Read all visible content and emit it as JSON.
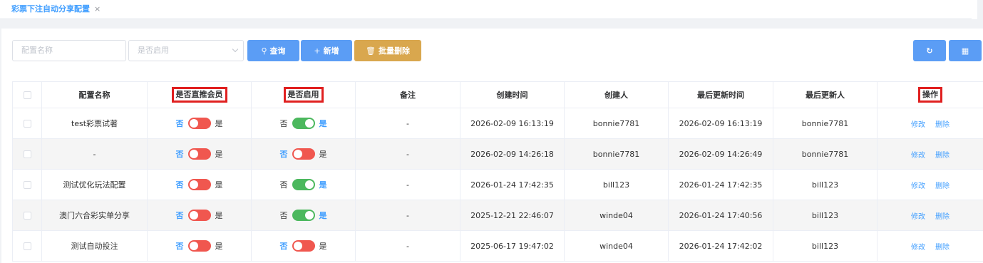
{
  "tab": {
    "title": "彩票下注自动分享配置",
    "close": "×"
  },
  "toolbar": {
    "name_placeholder": "配置名称",
    "enabled_placeholder": "是否启用",
    "query_label": "查询",
    "add_label": "新增",
    "batch_delete_label": "批量删除"
  },
  "table": {
    "headers": {
      "name": "配置名称",
      "direct_member": "是否直推会员",
      "enabled": "是否启用",
      "remark": "备注",
      "created_at": "创建时间",
      "creator": "创建人",
      "updated_at": "最后更新时间",
      "updater": "最后更新人",
      "actions": "操作"
    },
    "switch_no": "否",
    "switch_yes": "是",
    "edit_label": "修改",
    "delete_label": "删除",
    "rows": [
      {
        "name": "test彩票试著",
        "direct_member": false,
        "enabled": true,
        "remark": "-",
        "created_at": "2026-02-09 16:13:19",
        "creator": "bonnie7781",
        "updated_at": "2026-02-09 16:13:19",
        "updater": "bonnie7781"
      },
      {
        "name": "-",
        "direct_member": false,
        "enabled": false,
        "remark": "-",
        "created_at": "2026-02-09 14:26:18",
        "creator": "bonnie7781",
        "updated_at": "2026-02-09 14:26:49",
        "updater": "bonnie7781"
      },
      {
        "name": "测试优化玩法配置",
        "direct_member": false,
        "enabled": true,
        "remark": "-",
        "created_at": "2026-01-24 17:42:35",
        "creator": "bill123",
        "updated_at": "2026-01-24 17:42:35",
        "updater": "bill123"
      },
      {
        "name": "澳门六合彩实单分享",
        "direct_member": false,
        "enabled": true,
        "remark": "-",
        "created_at": "2025-12-21 22:46:07",
        "creator": "winde04",
        "updated_at": "2026-01-24 17:40:56",
        "updater": "bill123"
      },
      {
        "name": "测试自动投注",
        "direct_member": false,
        "enabled": false,
        "remark": "-",
        "created_at": "2025-06-17 19:47:02",
        "creator": "winde04",
        "updated_at": "2026-01-24 17:42:02",
        "updater": "bill123"
      }
    ]
  },
  "colors": {
    "primary": "#5b9df5",
    "warning": "#d9a74e",
    "switch_on": "#4cb85e",
    "switch_off": "#f0574f",
    "highlight": "#e02020"
  }
}
